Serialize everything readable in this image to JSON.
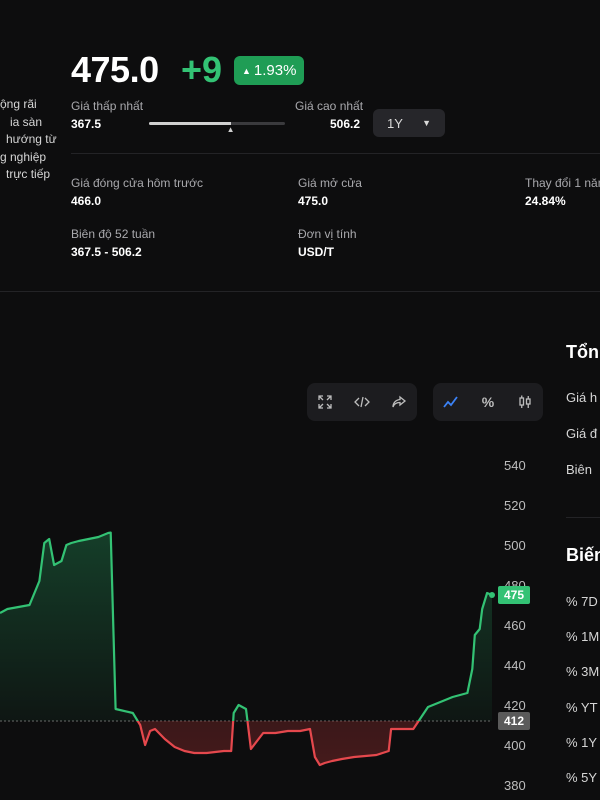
{
  "left_description": [
    "ộng rãi",
    "ia sàn",
    "hướng từ",
    "g nghiệp",
    "trực tiếp"
  ],
  "price": {
    "value": "475.0",
    "change": "+9",
    "change_percent": "1.93%",
    "up_arrow": "triangle-up-icon"
  },
  "range": {
    "low_label": "Giá thấp nhất",
    "low_value": "367.5",
    "high_label": "Giá cao nhất",
    "high_value": "506.2",
    "position_fraction": 0.6,
    "period": "1Y"
  },
  "stats": [
    {
      "label": "Giá đóng cửa hôm trước",
      "value": "466.0"
    },
    {
      "label": "Giá mở cửa",
      "value": "475.0"
    },
    {
      "label": "Thay đổi 1 năm",
      "value": "24.84%"
    },
    {
      "label": "Biên độ 52 tuần",
      "value": "367.5 - 506.2"
    },
    {
      "label": "Đơn vị tính",
      "value": "USD/T"
    }
  ],
  "toolbar": {
    "fullscreen_icon": "expand-icon",
    "embed_icon": "code-icon",
    "share_icon": "share-icon",
    "line_icon": "line-chart-icon",
    "percent_label": "%",
    "candle_icon": "candlestick-icon"
  },
  "chart_data": {
    "type": "line",
    "y_ticks": [
      "540",
      "520",
      "500",
      "480",
      "460",
      "440",
      "420",
      "400",
      "380"
    ],
    "ylim": [
      377,
      552
    ],
    "baseline": 412,
    "baseline_label": "412",
    "current_label": "475",
    "up_color": "#33c274",
    "down_color": "#e5484d",
    "points": [
      [
        0,
        466
      ],
      [
        0.015,
        468
      ],
      [
        0.06,
        470
      ],
      [
        0.08,
        482
      ],
      [
        0.09,
        501
      ],
      [
        0.1,
        503
      ],
      [
        0.11,
        490
      ],
      [
        0.125,
        492
      ],
      [
        0.135,
        500
      ],
      [
        0.145,
        501
      ],
      [
        0.16,
        502
      ],
      [
        0.18,
        503
      ],
      [
        0.2,
        504
      ],
      [
        0.22,
        506
      ],
      [
        0.225,
        506.2
      ],
      [
        0.235,
        418
      ],
      [
        0.27,
        416
      ],
      [
        0.285,
        410
      ],
      [
        0.295,
        400
      ],
      [
        0.305,
        407
      ],
      [
        0.315,
        408
      ],
      [
        0.335,
        403
      ],
      [
        0.355,
        399
      ],
      [
        0.375,
        397
      ],
      [
        0.395,
        396
      ],
      [
        0.42,
        396
      ],
      [
        0.455,
        397
      ],
      [
        0.47,
        397
      ],
      [
        0.475,
        416
      ],
      [
        0.485,
        420
      ],
      [
        0.5,
        418
      ],
      [
        0.51,
        398
      ],
      [
        0.535,
        406
      ],
      [
        0.56,
        406
      ],
      [
        0.585,
        407
      ],
      [
        0.61,
        407
      ],
      [
        0.63,
        408
      ],
      [
        0.64,
        394
      ],
      [
        0.65,
        390
      ],
      [
        0.66,
        391
      ],
      [
        0.675,
        392
      ],
      [
        0.695,
        393
      ],
      [
        0.72,
        394
      ],
      [
        0.765,
        395
      ],
      [
        0.79,
        397
      ],
      [
        0.795,
        408
      ],
      [
        0.84,
        408
      ],
      [
        0.87,
        419
      ],
      [
        0.89,
        421
      ],
      [
        0.92,
        424
      ],
      [
        0.95,
        426
      ],
      [
        0.96,
        438
      ],
      [
        0.965,
        455
      ],
      [
        0.975,
        458
      ],
      [
        0.98,
        468
      ],
      [
        0.99,
        476
      ],
      [
        1.0,
        475
      ]
    ]
  },
  "right_panel": {
    "title_1": "Tổn",
    "rows_1": [
      "Giá h",
      "Giá đ",
      "Biên"
    ],
    "title_2": "Biến",
    "rows_2": [
      "% 7D",
      "% 1M",
      "% 3M",
      "% YT",
      "% 1Y",
      "% 5Y"
    ]
  }
}
